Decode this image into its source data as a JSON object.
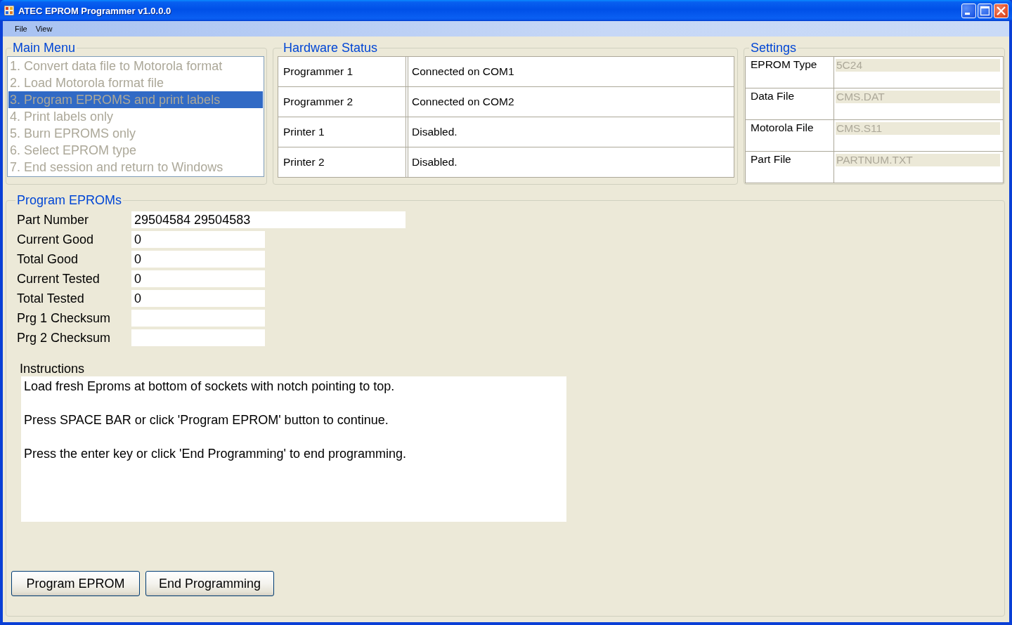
{
  "window": {
    "title": "ATEC EPROM Programmer v1.0.0.0"
  },
  "menu_bar": [
    "File",
    "View"
  ],
  "main_menu": {
    "title": "Main Menu",
    "disabled": true,
    "items": [
      {
        "label": "1. Convert data file to Motorola format",
        "selected": false
      },
      {
        "label": "2. Load Motorola format file",
        "selected": false
      },
      {
        "label": "3. Program EPROMS and print labels",
        "selected": true
      },
      {
        "label": "4. Print labels only",
        "selected": false
      },
      {
        "label": "5. Burn EPROMS only",
        "selected": false
      },
      {
        "label": "6. Select EPROM type",
        "selected": false
      },
      {
        "label": "7. End session and return to Windows",
        "selected": false
      }
    ]
  },
  "hardware_status": {
    "title": "Hardware Status",
    "rows": [
      {
        "label": "Programmer 1",
        "value": "Connected on COM1"
      },
      {
        "label": "Programmer 2",
        "value": "Connected on COM2"
      },
      {
        "label": "Printer 1",
        "value": "Disabled."
      },
      {
        "label": "Printer 2",
        "value": "Disabled."
      }
    ]
  },
  "settings": {
    "title": "Settings",
    "rows": [
      {
        "label": "EPROM Type",
        "value": "5C24",
        "disabled": true
      },
      {
        "label": "Data File",
        "value": "CMS.DAT",
        "disabled": true
      },
      {
        "label": "Motorola File",
        "value": "CMS.S11",
        "disabled": true
      },
      {
        "label": "Part File",
        "value": "PARTNUM.TXT",
        "disabled": true
      }
    ]
  },
  "program_eproms": {
    "title": "Program EPROMs",
    "fields": [
      {
        "label": "Part Number",
        "value": "29504584 29504583",
        "kind": "long"
      },
      {
        "label": "Current Good",
        "value": "0",
        "kind": "short"
      },
      {
        "label": "Total Good",
        "value": "0",
        "kind": "short"
      },
      {
        "label": "Current Tested",
        "value": "0",
        "kind": "short"
      },
      {
        "label": "Total Tested",
        "value": "0",
        "kind": "short"
      },
      {
        "label": "Prg 1 Checksum",
        "kind": "short"
      },
      {
        "label": "Prg 2 Checksum",
        "kind": "short"
      }
    ],
    "instructions": {
      "label": "Instructions",
      "paragraphs": [
        "Load fresh Eproms at bottom of sockets with notch pointing to top.",
        "Press SPACE BAR or click 'Program EPROM' button to continue.",
        "Press the enter key or click 'End Programming' to end programming."
      ]
    },
    "buttons": [
      "Program EPROM",
      "End Programming"
    ]
  }
}
